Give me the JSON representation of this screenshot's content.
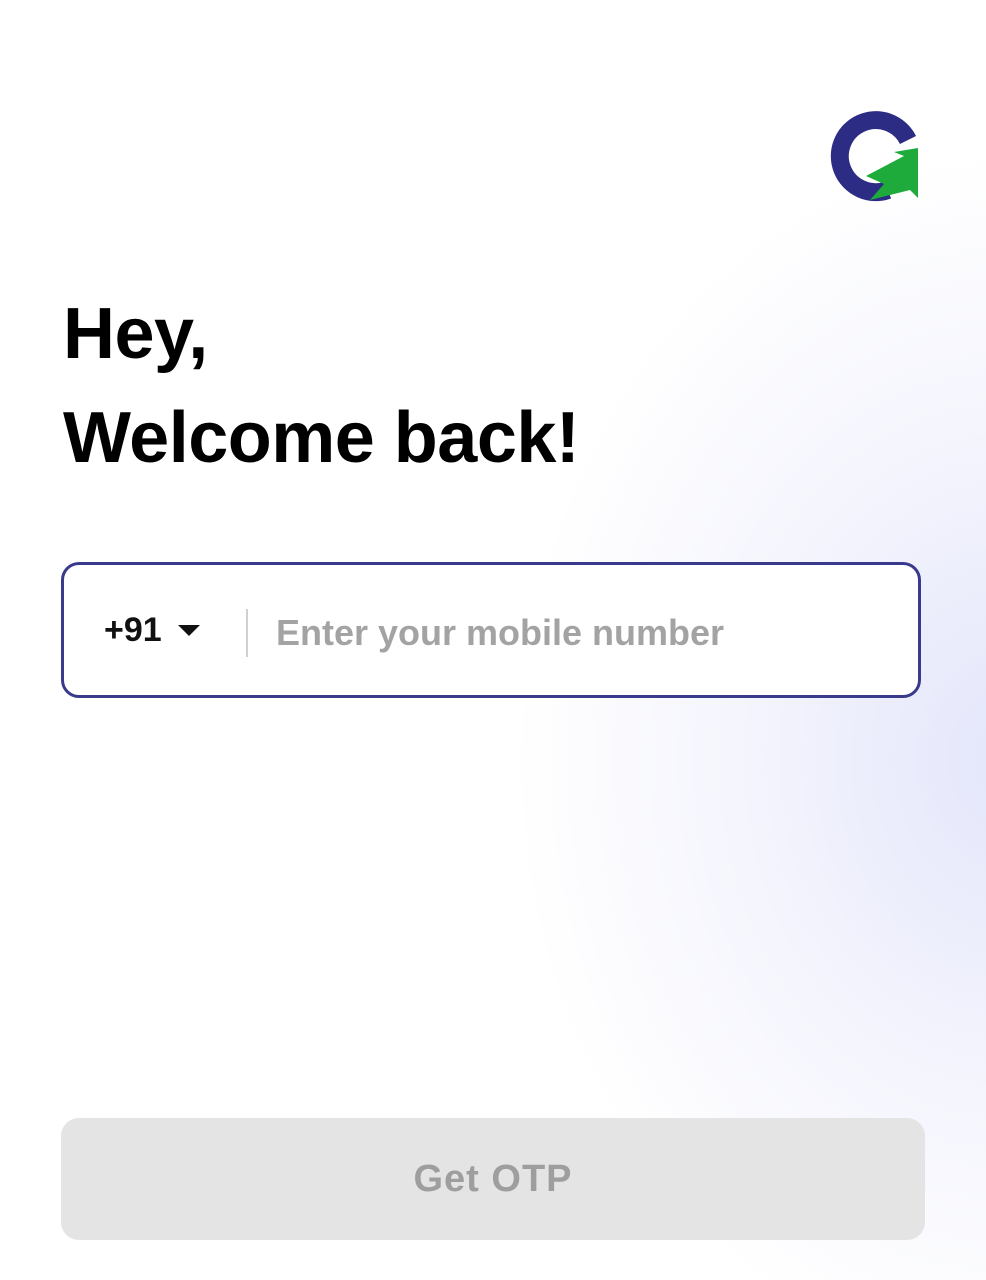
{
  "logo": {
    "icon": "brand-g-logo-icon",
    "colors": {
      "primary": "#2c2c84",
      "accent": "#1faa3c"
    }
  },
  "greeting": {
    "line1": "Hey,",
    "line2": "Welcome back!"
  },
  "phone": {
    "country_code": "+91",
    "dropdown_icon": "caret-down-icon",
    "placeholder": "Enter your mobile number",
    "value": ""
  },
  "cta": {
    "label": "Get OTP",
    "state": "disabled"
  }
}
